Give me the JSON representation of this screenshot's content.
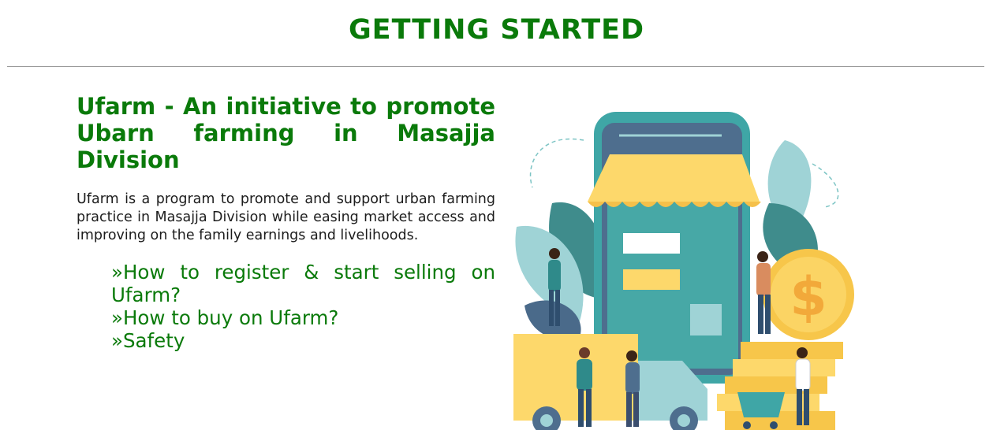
{
  "page": {
    "title": "GETTING STARTED"
  },
  "intro_section": {
    "headline": "Ufarm - An initiative to promote Ubarn farming in Masajja Division",
    "description": "Ufarm is a program to promote and support urban farming practice in Masajja Division while easing market access and improving on the family earnings and livelihoods."
  },
  "guide_links": [
    {
      "label": "»How to register & start selling on Ufarm?"
    },
    {
      "label": "»How to buy on Ufarm?"
    },
    {
      "label": "»Safety"
    }
  ],
  "colors": {
    "heading_green": "#0a7a0a",
    "phone_teal": "#3fa6a6",
    "awning_yellow": "#fdd86b",
    "coin_gold": "#f7c64a"
  },
  "illustration": {
    "icon": "online-market-phone-illustration"
  }
}
